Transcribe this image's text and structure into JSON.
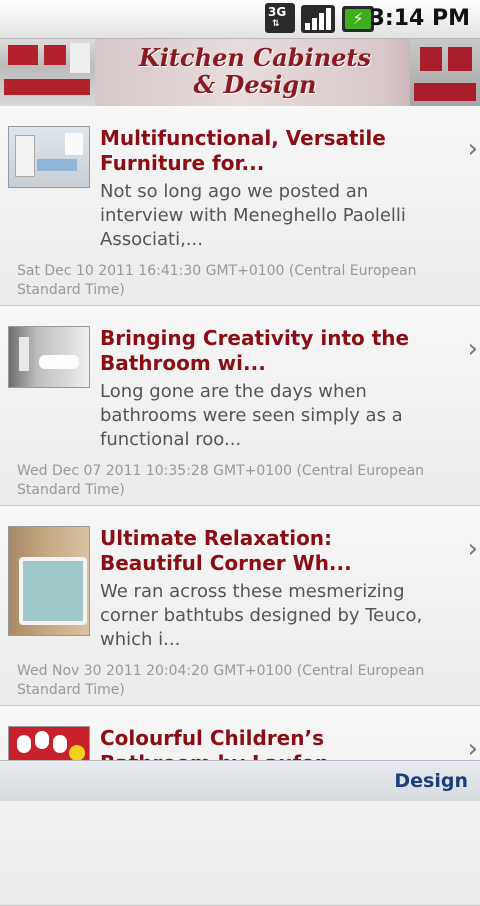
{
  "status_bar": {
    "network_label": "3G",
    "time": "3:14 PM",
    "icons": [
      "network-3g-icon",
      "signal-icon",
      "battery-charging-icon"
    ]
  },
  "header": {
    "title_line1": "Kitchen Cabinets",
    "title_line2": "& Design"
  },
  "articles": [
    {
      "title": "Multifunctional, Versatile Furniture for...",
      "summary": "Not so long ago we posted an interview with Meneghello Paolelli Associati,...",
      "date": "Sat Dec 10 2011 16:41:30 GMT+0100 (Central European Standard Time)"
    },
    {
      "title": "Bringing Creativity into the Bathroom wi...",
      "summary": "Long gone are the days when bathrooms were seen simply as a functional roo...",
      "date": "Wed Dec 07 2011 10:35:28 GMT+0100 (Central European Standard Time)"
    },
    {
      "title": "Ultimate Relaxation: Beautiful Corner Wh...",
      "summary": "We ran across these mesmerizing corner bathtubs designed by Teuco, which i...",
      "date": "Wed Nov 30 2011 20:04:20 GMT+0100 (Central European Standard Time)"
    },
    {
      "title": "Colourful Children’s Bathroom by Laufen",
      "summary": "",
      "date": ""
    }
  ],
  "bottom_bar": {
    "label": "Design"
  },
  "colors": {
    "title": "#8b0d16",
    "link": "#1e3e7a"
  }
}
